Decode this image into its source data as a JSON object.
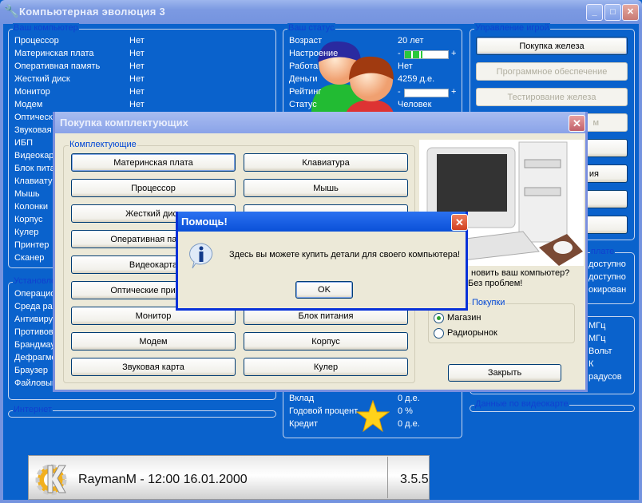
{
  "window": {
    "title": "Компьютерная эволюция 3",
    "min": "_",
    "max": "□",
    "close": "✕"
  },
  "computer": {
    "title": "Ваш компьютер",
    "items": [
      {
        "label": "Процессор",
        "value": "Нет"
      },
      {
        "label": "Материнская плата",
        "value": "Нет"
      },
      {
        "label": "Оперативная память",
        "value": "Нет"
      },
      {
        "label": "Жесткий диск",
        "value": "Нет"
      },
      {
        "label": "Монитор",
        "value": "Нет"
      },
      {
        "label": "Модем",
        "value": "Нет"
      },
      {
        "label": "Оптический привод",
        "value": ""
      },
      {
        "label": "Звуковая карта",
        "value": ""
      },
      {
        "label": "ИБП",
        "value": ""
      },
      {
        "label": "Видеокарта",
        "value": ""
      },
      {
        "label": "Блок питания",
        "value": ""
      },
      {
        "label": "Клавиатура",
        "value": ""
      },
      {
        "label": "Мышь",
        "value": ""
      },
      {
        "label": "Колонки",
        "value": ""
      },
      {
        "label": "Корпус",
        "value": ""
      },
      {
        "label": "Кулер",
        "value": ""
      },
      {
        "label": "Принтер",
        "value": ""
      },
      {
        "label": "Сканер",
        "value": ""
      }
    ]
  },
  "software": {
    "title": "Установленное ПО",
    "items": [
      "Операционная система",
      "Среда разработки",
      "Антивирус",
      "Противовирусный",
      "Брандмауэр",
      "Дефрагментатор",
      "Браузер",
      "Файловый менеджер"
    ]
  },
  "internet": {
    "title": "Интернет"
  },
  "status": {
    "title": "Ваш статус",
    "age_label": "Возраст",
    "age": "20 лет",
    "mood_label": "Настроение",
    "mood_level": 0.4,
    "job_label": "Работа",
    "job": "Нет",
    "money_label": "Деньги",
    "money": "4259 д.е.",
    "rating_label": "Рейтинг",
    "rating_level": 0,
    "status_label": "Статус",
    "status": "Человек",
    "minus": "-",
    "plus": "+",
    "deposit_label": "Вклад",
    "deposit": "0 д.е.",
    "rate_label": "Годовой процент",
    "rate": "0 %",
    "credit_label": "Кредит",
    "credit": "0 д.е."
  },
  "control": {
    "title": "Управление игрой",
    "buttons": [
      "Покупка железа",
      "Программное обеспечение",
      "Тестирование железа",
      "м",
      "",
      "ия",
      "",
      ""
    ]
  },
  "board": {
    "title": "плате",
    "items": [
      "доступно",
      "доступно",
      "окирован"
    ]
  },
  "sensors": {
    "items": [
      "МГц",
      "МГц",
      "Вольт",
      "К",
      "радусов"
    ]
  },
  "video": {
    "title": "Данные по видеокарте"
  },
  "statusbar": {
    "text": "RaymanM - 12:00 16.01.2000",
    "version": "3.5.5"
  },
  "shop": {
    "title": "Покупка комплектующих",
    "group": "Комплектующие",
    "col1": [
      "Материнская плата",
      "Процессор",
      "Жесткий диск",
      "Оперативная память",
      "Видеокарта",
      "Оптические приводы",
      "Монитор",
      "Модем",
      "Звуковая карта"
    ],
    "col2": [
      "Клавиатура",
      "Мышь",
      "",
      "",
      "",
      "",
      "Блок питания",
      "Корпус",
      "Кулер"
    ],
    "promo1": "новить ваш компьютер?",
    "promo2": "Без проблем!",
    "purchase_group": "Покупки",
    "radio1": "Магазин",
    "radio2": "Радиорынок",
    "close": "Закрыть"
  },
  "help": {
    "title": "Помощь!",
    "message": "Здесь вы можете купить детали для своего компьютера!",
    "ok": "OK"
  }
}
